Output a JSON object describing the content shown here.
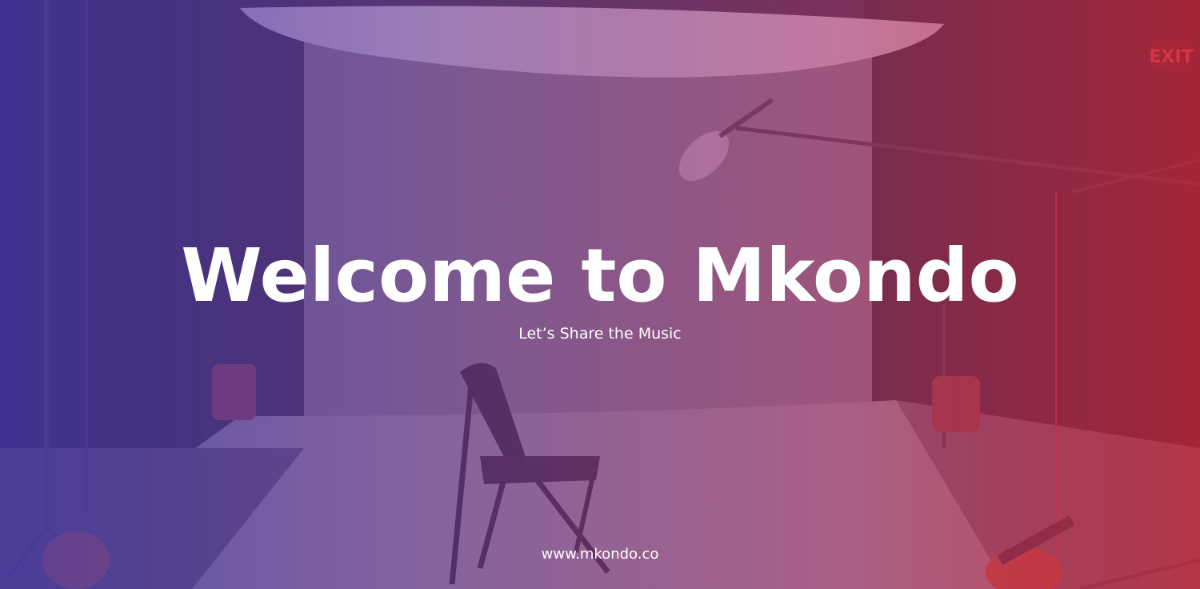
{
  "hero": {
    "title": "Welcome to Mkondo",
    "subtitle": "Let’s Share the Music"
  },
  "footer": {
    "url": "www.mkondo.co"
  },
  "background": {
    "sign_text": "EXIT"
  },
  "colors": {
    "overlay_left": "#4637aa",
    "overlay_right": "#c8283c",
    "text": "#ffffff"
  }
}
